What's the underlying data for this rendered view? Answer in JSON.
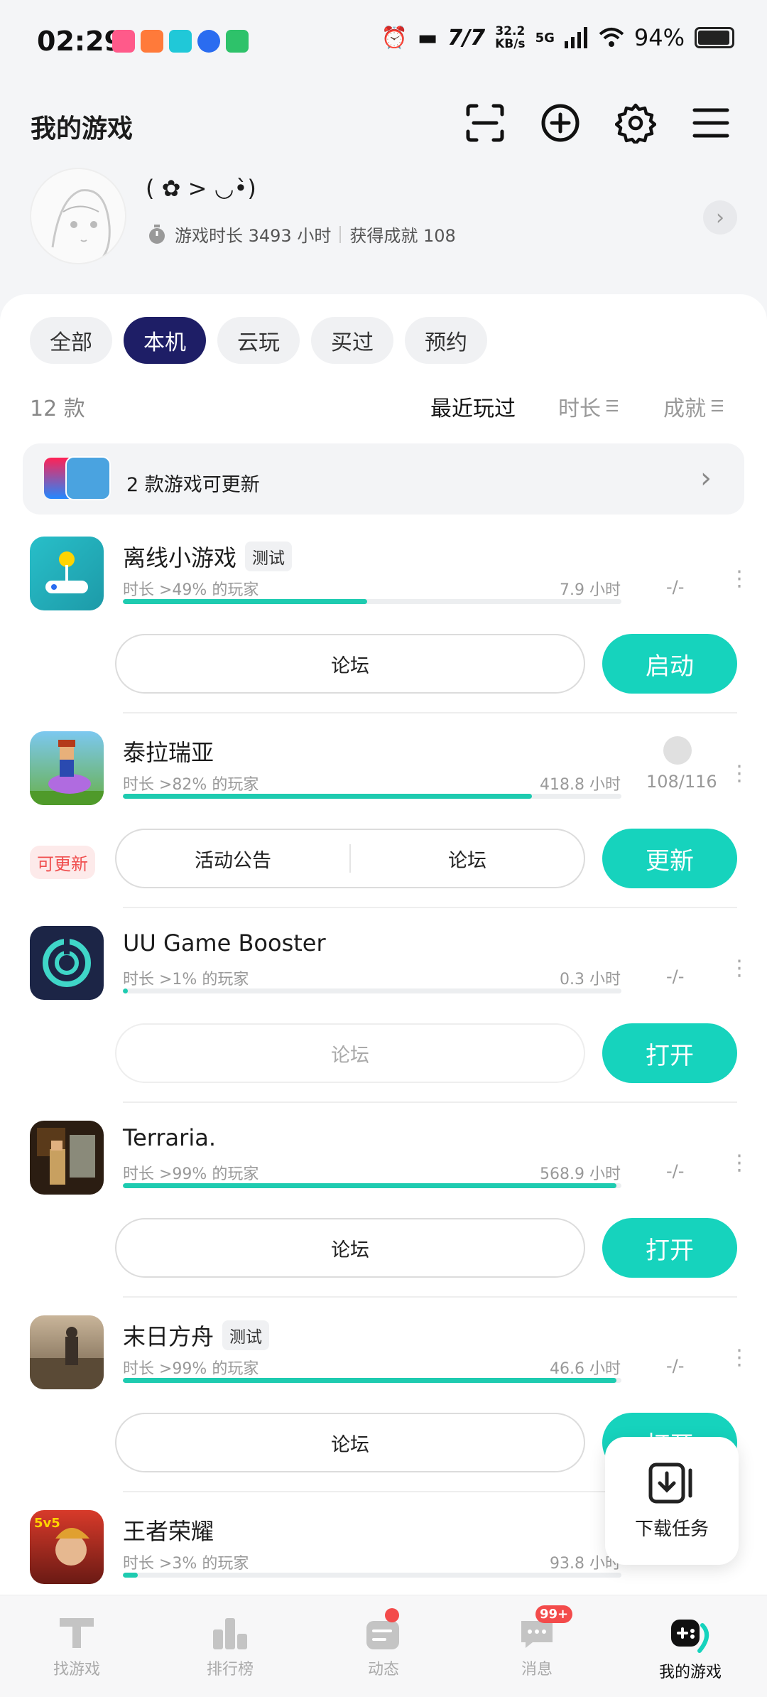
{
  "status_bar": {
    "time": "02:29",
    "net_speed_value": "32.2",
    "net_speed_unit": "KB/s",
    "network": "5G",
    "battery": "94%"
  },
  "header": {
    "title": "我的游戏",
    "icons": [
      "scan-icon",
      "add-icon",
      "gear-icon",
      "menu-icon"
    ]
  },
  "profile": {
    "nickname": "( ✿ > ◡•̀)",
    "play_time": "游戏时长 3493 小时",
    "achievements": "获得成就 108"
  },
  "filters": {
    "chips": [
      "全部",
      "本机",
      "云玩",
      "买过",
      "预约"
    ],
    "active": "本机"
  },
  "list_header": {
    "count": "12 款",
    "sort_recent": "最近玩过",
    "sort_duration": "时长",
    "sort_achievement": "成就"
  },
  "update_banner": {
    "text": "2 款游戏可更新"
  },
  "games": [
    {
      "name": "离线小游戏",
      "tag": "测试",
      "pct": "时长 >49% 的玩家",
      "hours": "7.9 小时",
      "progress": 0.49,
      "ach": "-/-",
      "links": [
        "论坛"
      ],
      "action": "启动",
      "update_tag": ""
    },
    {
      "name": "泰拉瑞亚",
      "tag": "",
      "pct": "时长 >82% 的玩家",
      "hours": "418.8 小时",
      "progress": 0.82,
      "ach": "108/116",
      "links": [
        "活动公告",
        "论坛"
      ],
      "action": "更新",
      "update_tag": "可更新"
    },
    {
      "name": "UU Game Booster",
      "tag": "",
      "pct": "时长 >1% 的玩家",
      "hours": "0.3 小时",
      "progress": 0.01,
      "ach": "-/-",
      "links": [
        "论坛"
      ],
      "action": "打开",
      "update_tag": ""
    },
    {
      "name": "Terraria.",
      "tag": "",
      "pct": "时长 >99% 的玩家",
      "hours": "568.9 小时",
      "progress": 0.99,
      "ach": "-/-",
      "links": [
        "论坛"
      ],
      "action": "打开",
      "update_tag": ""
    },
    {
      "name": "末日方舟",
      "tag": "测试",
      "pct": "时长 >99% 的玩家",
      "hours": "46.6 小时",
      "progress": 0.99,
      "ach": "-/-",
      "links": [
        "论坛"
      ],
      "action": "打开",
      "update_tag": ""
    },
    {
      "name": "王者荣耀",
      "tag": "",
      "pct": "时长 >3% 的玩家",
      "hours": "93.8 小时",
      "progress": 0.03,
      "ach": "",
      "links": [],
      "action": "",
      "update_tag": ""
    }
  ],
  "floating": {
    "label": "下载任务"
  },
  "tabbar": {
    "tabs": [
      "找游戏",
      "排行榜",
      "动态",
      "消息",
      "我的游戏"
    ],
    "active": "我的游戏",
    "message_badge": "99+"
  },
  "colors": {
    "accent": "#16d3bd",
    "chip_active": "#1e1e66",
    "badge": "#f34b4b"
  }
}
